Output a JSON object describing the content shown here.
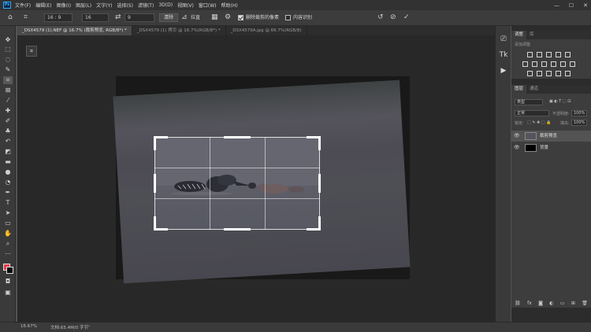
{
  "app": {
    "logo": "Ps"
  },
  "menu": [
    "文件(F)",
    "编辑(E)",
    "图像(I)",
    "图层(L)",
    "文字(Y)",
    "选择(S)",
    "滤镜(T)",
    "3D(D)",
    "视图(V)",
    "窗口(W)",
    "帮助(H)"
  ],
  "window_controls": {
    "minimize": "—",
    "maximize": "☐",
    "close": "✕"
  },
  "options": {
    "ratio": "16 : 9",
    "ratio_w": "16",
    "ratio_h": "9",
    "clear_label": "清除",
    "straighten_label": "拉直",
    "delete_cropped_label": "删除裁剪的像素",
    "delete_cropped_checked": true,
    "content_aware_label": "内容识别",
    "content_aware_checked": false
  },
  "tabs": [
    {
      "label": "_DSX4579 (1).NEF @ 16.7% (裁剪预览, RGB/8*) *",
      "active": true
    },
    {
      "label": "_DSX4579 (1) 拷贝 @ 16.7%(RGB/8*) *",
      "active": false
    },
    {
      "label": "_DSX4579A.jpg @ 66.7%(RGB/8)",
      "active": false
    }
  ],
  "panels": {
    "adjust_tabs": [
      "调整",
      "库"
    ],
    "adjust_title": "添加调整",
    "layers_tabs": [
      "图层",
      "通道"
    ],
    "kind_placeholder": "类型",
    "blend_mode": "正常",
    "opacity_label": "不透明度:",
    "opacity_value": "100%",
    "lock_label": "锁定:",
    "fill_label": "填充:",
    "fill_value": "100%",
    "layers": [
      {
        "name": "裁剪预览",
        "selected": true
      },
      {
        "name": "背景",
        "selected": false
      }
    ]
  },
  "status": {
    "zoom": "16.67%",
    "doc": "文档:65.4M/0 字节"
  },
  "colors": {
    "foreground": "#e3404c",
    "background": "#0a0a0a"
  }
}
